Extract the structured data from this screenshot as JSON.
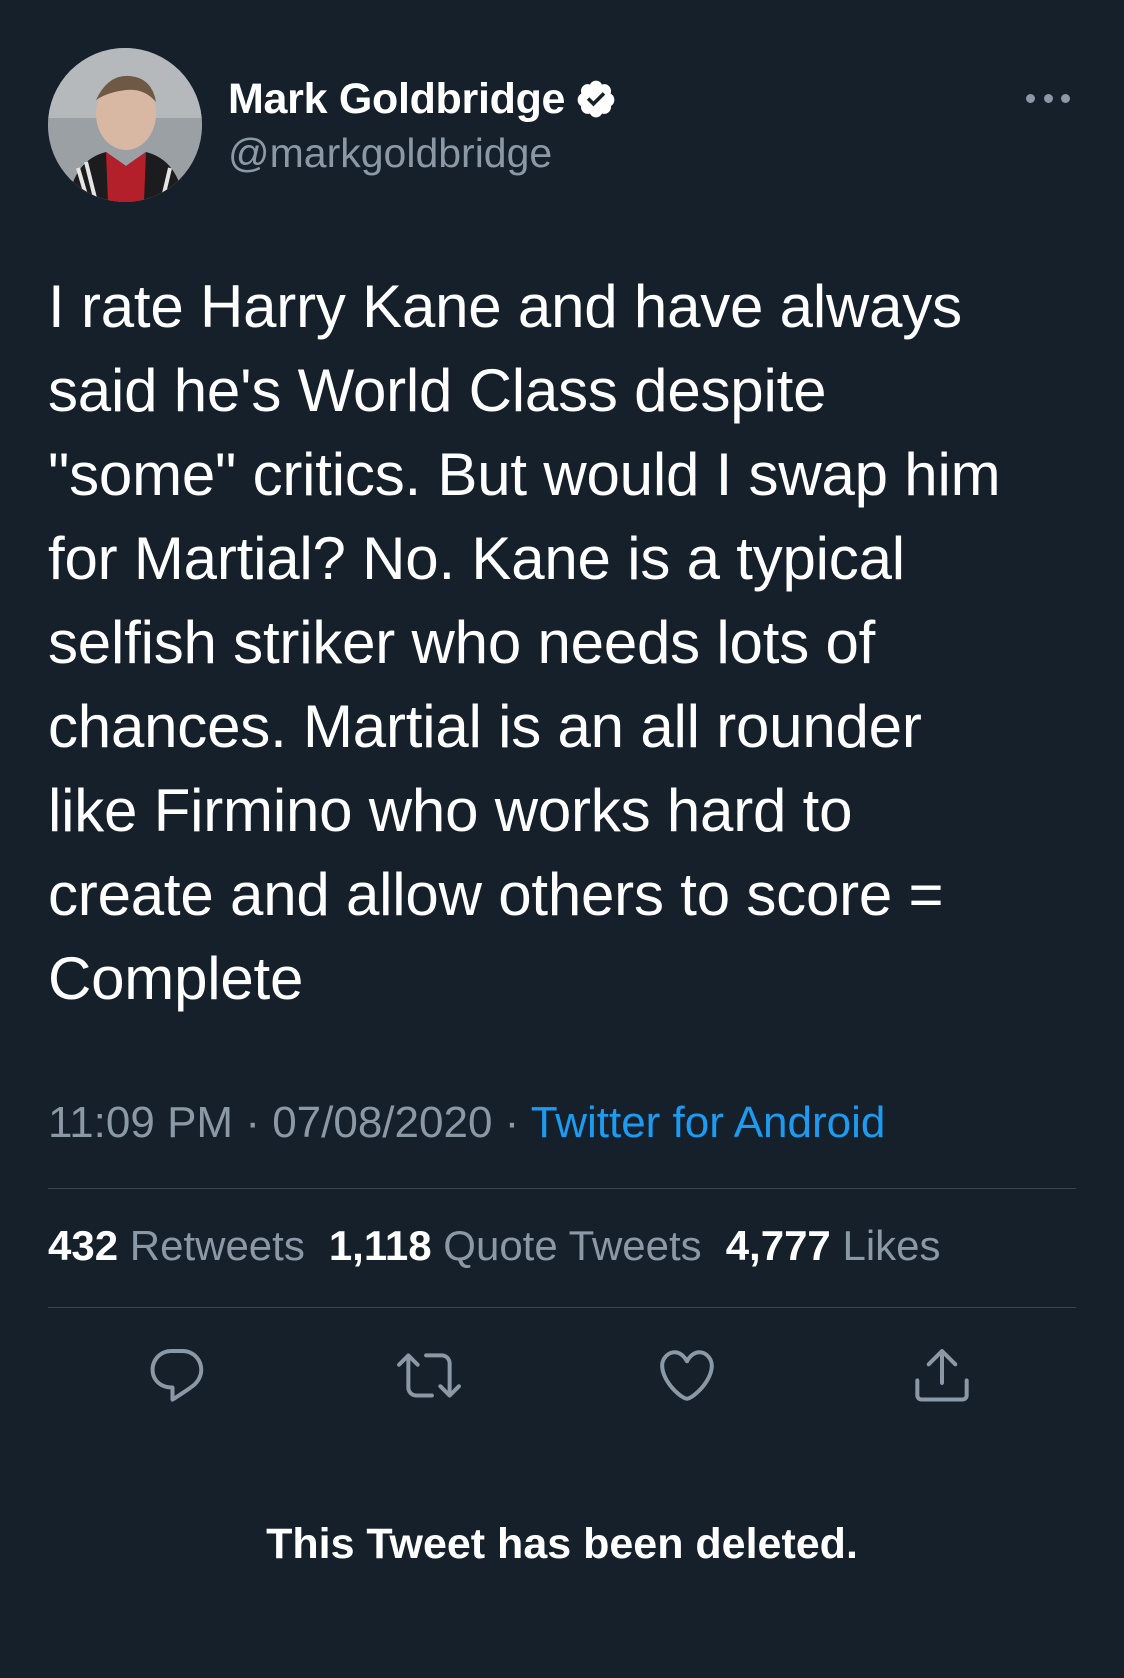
{
  "author": {
    "display_name": "Mark Goldbridge",
    "handle": "@markgoldbridge",
    "verified": true
  },
  "tweet": {
    "text": "I rate Harry Kane and have always\nsaid he's World Class despite\n\"some\" critics. But would I swap him\nfor Martial? No. Kane is a typical\nselfish striker who needs lots of\nchances. Martial is an all rounder\nlike Firmino who works hard to\ncreate and allow others to score =\nComplete",
    "time": "11:09 PM",
    "date": "07/08/2020",
    "source": "Twitter for Android",
    "separator": "·"
  },
  "stats": {
    "retweets_count": "432",
    "retweets_label": "Retweets",
    "quotes_count": "1,118",
    "quotes_label": "Quote Tweets",
    "likes_count": "4,777",
    "likes_label": "Likes"
  },
  "actions": {
    "reply_icon": "reply-icon",
    "retweet_icon": "retweet-icon",
    "like_icon": "heart-icon",
    "share_icon": "share-icon"
  },
  "notice": {
    "deleted": "This Tweet has been deleted."
  },
  "colors": {
    "background": "#15202b",
    "text_primary": "#ffffff",
    "text_secondary": "#8b98a5",
    "link": "#1d9bf0",
    "divider": "#38444d"
  }
}
